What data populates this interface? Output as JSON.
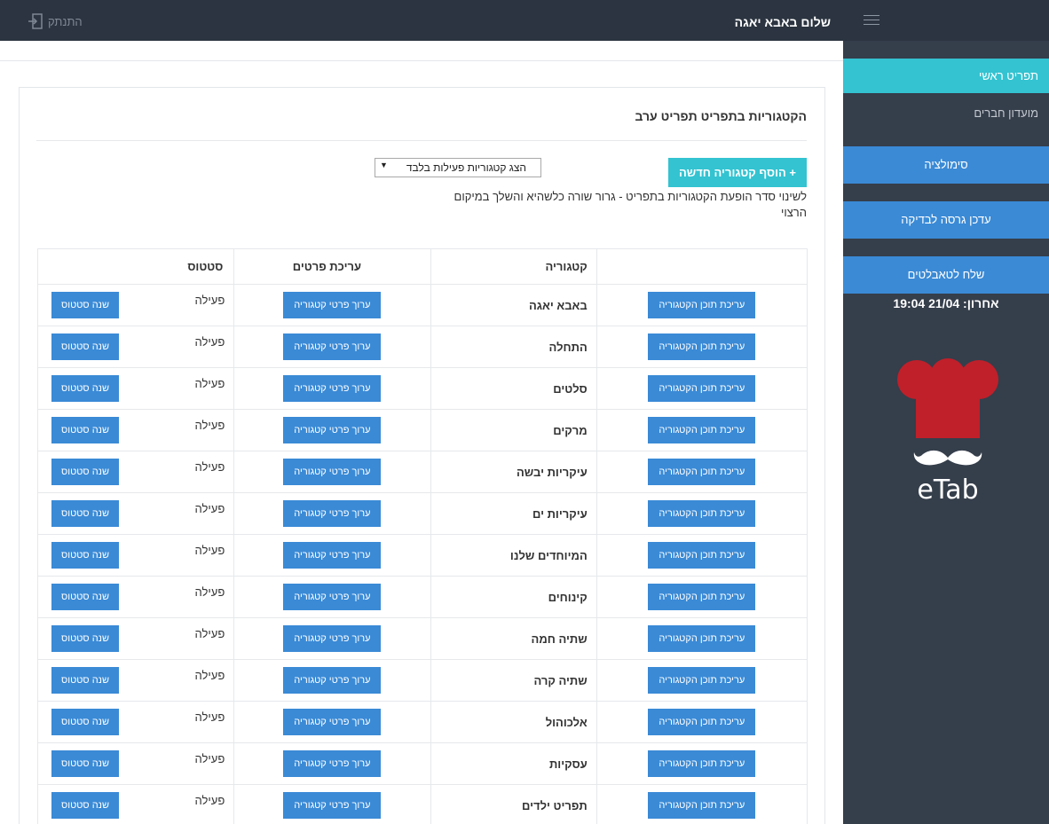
{
  "header": {
    "greeting": "שלום באבא יאגה",
    "logout_label": "התנתק"
  },
  "sidebar": {
    "main_menu": "תפריט ראשי",
    "club_members": "מועדון חברים",
    "simulation": "סימולציה",
    "update_version": "עדכן גרסה לבדיקה",
    "send_tablets": "שלח לטאבלטים",
    "last_sent": "אחרון: 21/04 19:04",
    "logo_text": "eTab"
  },
  "page": {
    "title": "הקטגוריות בתפריט תפריט ערב",
    "add_button": "+ הוסף קטגוריה חדשה",
    "filter_value": "הצג קטגוריות פעילות בלבד",
    "note": "לשינוי סדר הופעת הקטגוריות בתפריט - גרור שורה כלשהיא והשלך במיקום הרצוי"
  },
  "table": {
    "headers": [
      "",
      "קטגוריה",
      "עריכת פרטים",
      "סטטוס"
    ],
    "edit_content_label": "עריכת תוכן הקטגוריה",
    "edit_details_label": "ערוך פרטי קטגוריה",
    "change_status_label": "שנה סטטוס",
    "rows": [
      {
        "name": "באבא יאגה",
        "status": "פעילה"
      },
      {
        "name": "התחלה",
        "status": "פעילה"
      },
      {
        "name": "סלטים",
        "status": "פעילה"
      },
      {
        "name": "מרקים",
        "status": "פעילה"
      },
      {
        "name": "עיקריות יבשה",
        "status": "פעילה"
      },
      {
        "name": "עיקריות ים",
        "status": "פעילה"
      },
      {
        "name": "המיוחדים שלנו",
        "status": "פעילה"
      },
      {
        "name": "קינוחים",
        "status": "פעילה"
      },
      {
        "name": "שתיה חמה",
        "status": "פעילה"
      },
      {
        "name": "שתיה קרה",
        "status": "פעילה"
      },
      {
        "name": "אלכוהול",
        "status": "פעילה"
      },
      {
        "name": "עסקיות",
        "status": "פעילה"
      },
      {
        "name": "תפריט ילדים",
        "status": "פעילה"
      }
    ]
  },
  "colors": {
    "topbar": "#2b3440",
    "sidebar": "#353e4b",
    "accent_cyan": "#33c3d1",
    "button_blue": "#3a8ad6",
    "logo_red": "#c0202a"
  }
}
